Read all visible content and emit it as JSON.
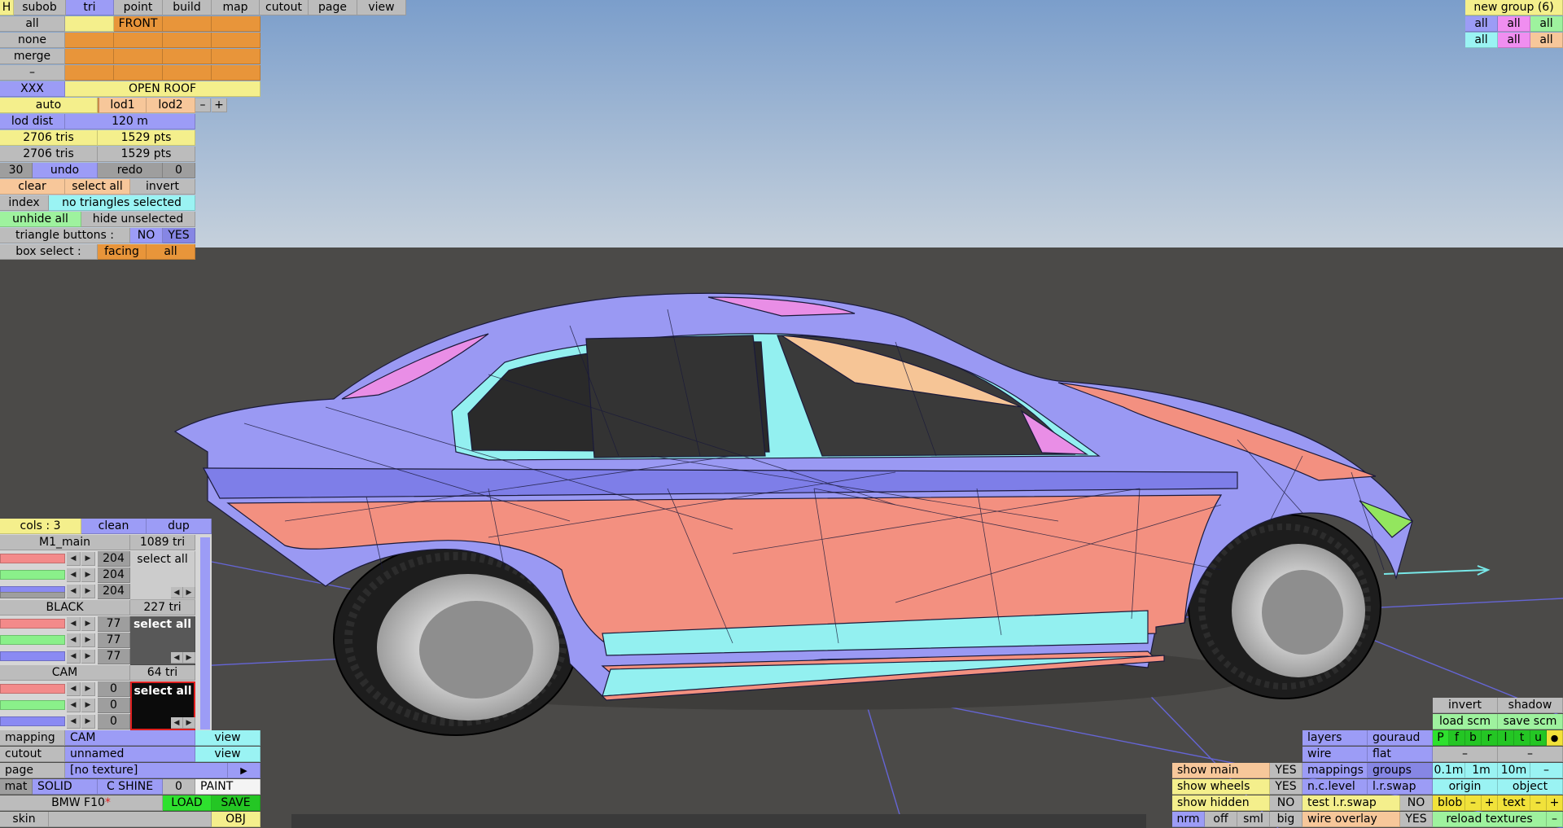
{
  "top_menu": {
    "h": "H",
    "subob": "subob",
    "tri": "tri",
    "point": "point",
    "build": "build",
    "map": "map",
    "cutout": "cutout",
    "page": "page",
    "view": "view"
  },
  "groups_panel": {
    "all": "all",
    "none": "none",
    "merge": "merge",
    "dash": "–",
    "xxx": "XXX",
    "front": "FRONT",
    "open_roof": "OPEN ROOF",
    "auto": "auto",
    "lod1": "lod1",
    "lod2": "lod2",
    "minus": "–",
    "plus": "+",
    "lod_dist_label": "lod dist",
    "lod_dist_value": "120 m",
    "tris1": "2706 tris",
    "pts1": "1529 pts",
    "tris2": "2706 tris",
    "pts2": "1529 pts",
    "undo_count": "30",
    "undo": "undo",
    "redo": "redo",
    "redo_count": "0",
    "clear": "clear",
    "select_all": "select all",
    "invert": "invert",
    "index": "index",
    "no_selection": "no triangles selected",
    "unhide_all": "unhide all",
    "hide_unselected": "hide unselected",
    "triangle_buttons": "triangle buttons :",
    "no": "NO",
    "yes": "YES",
    "box_select": "box select :",
    "facing": "facing",
    "box_all": "all"
  },
  "group_menu": {
    "title": "new group (6)",
    "all": "all"
  },
  "materials_panel": {
    "cols": "cols : 3",
    "clean": "clean",
    "dup": "dup",
    "materials": [
      {
        "name": "M1_main",
        "tri": "1089 tri",
        "r": "204",
        "g": "204",
        "b": "204",
        "select": "select all"
      },
      {
        "name": "BLACK",
        "tri": "227 tri",
        "r": "77",
        "g": "77",
        "b": "77",
        "select": "select all"
      },
      {
        "name": "CAM",
        "tri": "64 tri",
        "r": "0",
        "g": "0",
        "b": "0",
        "select": "select all"
      }
    ]
  },
  "bottom_left": {
    "mapping": "mapping",
    "mapping_value": "CAM",
    "view": "view",
    "cutout": "cutout",
    "cutout_value": "unnamed",
    "page": "page",
    "page_value": "[no texture]",
    "page_arrow": "▶",
    "mat": "mat",
    "solid": "SOLID",
    "c_shine": "C SHINE",
    "shine_value": "0",
    "paint": "PAINT",
    "model_name": "BMW F10",
    "modified_mark": "*",
    "load": "LOAD",
    "save": "SAVE",
    "skin": "skin",
    "obj": "OBJ"
  },
  "view_panel": {
    "show_main": "show main",
    "show_wheels": "show wheels",
    "show_hidden": "show hidden",
    "yes": "YES",
    "no": "NO",
    "nrm": "nrm",
    "off": "off",
    "sml": "sml",
    "big": "big",
    "layers": "layers",
    "gouraud": "gouraud",
    "wire": "wire",
    "flat": "flat",
    "mappings": "mappings",
    "groups": "groups",
    "nc_level": "n.c.level",
    "lr_swap": "l.r.swap",
    "test_lr_swap": "test l.r.swap",
    "wire_overlay": "wire overlay",
    "invert": "invert",
    "shadow": "shadow",
    "load_scm": "load scm",
    "save_scm": "save scm",
    "views": [
      "P",
      "f",
      "b",
      "r",
      "l",
      "t",
      "u"
    ],
    "dot": "●",
    "dash": "–",
    "step1": "0.1m",
    "step2": "1m",
    "step3": "10m",
    "origin": "origin",
    "object": "object",
    "blob": "blob",
    "text": "text",
    "plus": "+",
    "reload_textures": "reload textures"
  },
  "colors": {
    "sky_top": "#7b9ecb",
    "sky_bottom": "#c9d3dd",
    "ground": "#4b4a48",
    "body": "#9a99f3",
    "paint": "#f39080",
    "trim": "#93f0f0",
    "glass": "#f6c596",
    "accent": "#e98ee6"
  }
}
